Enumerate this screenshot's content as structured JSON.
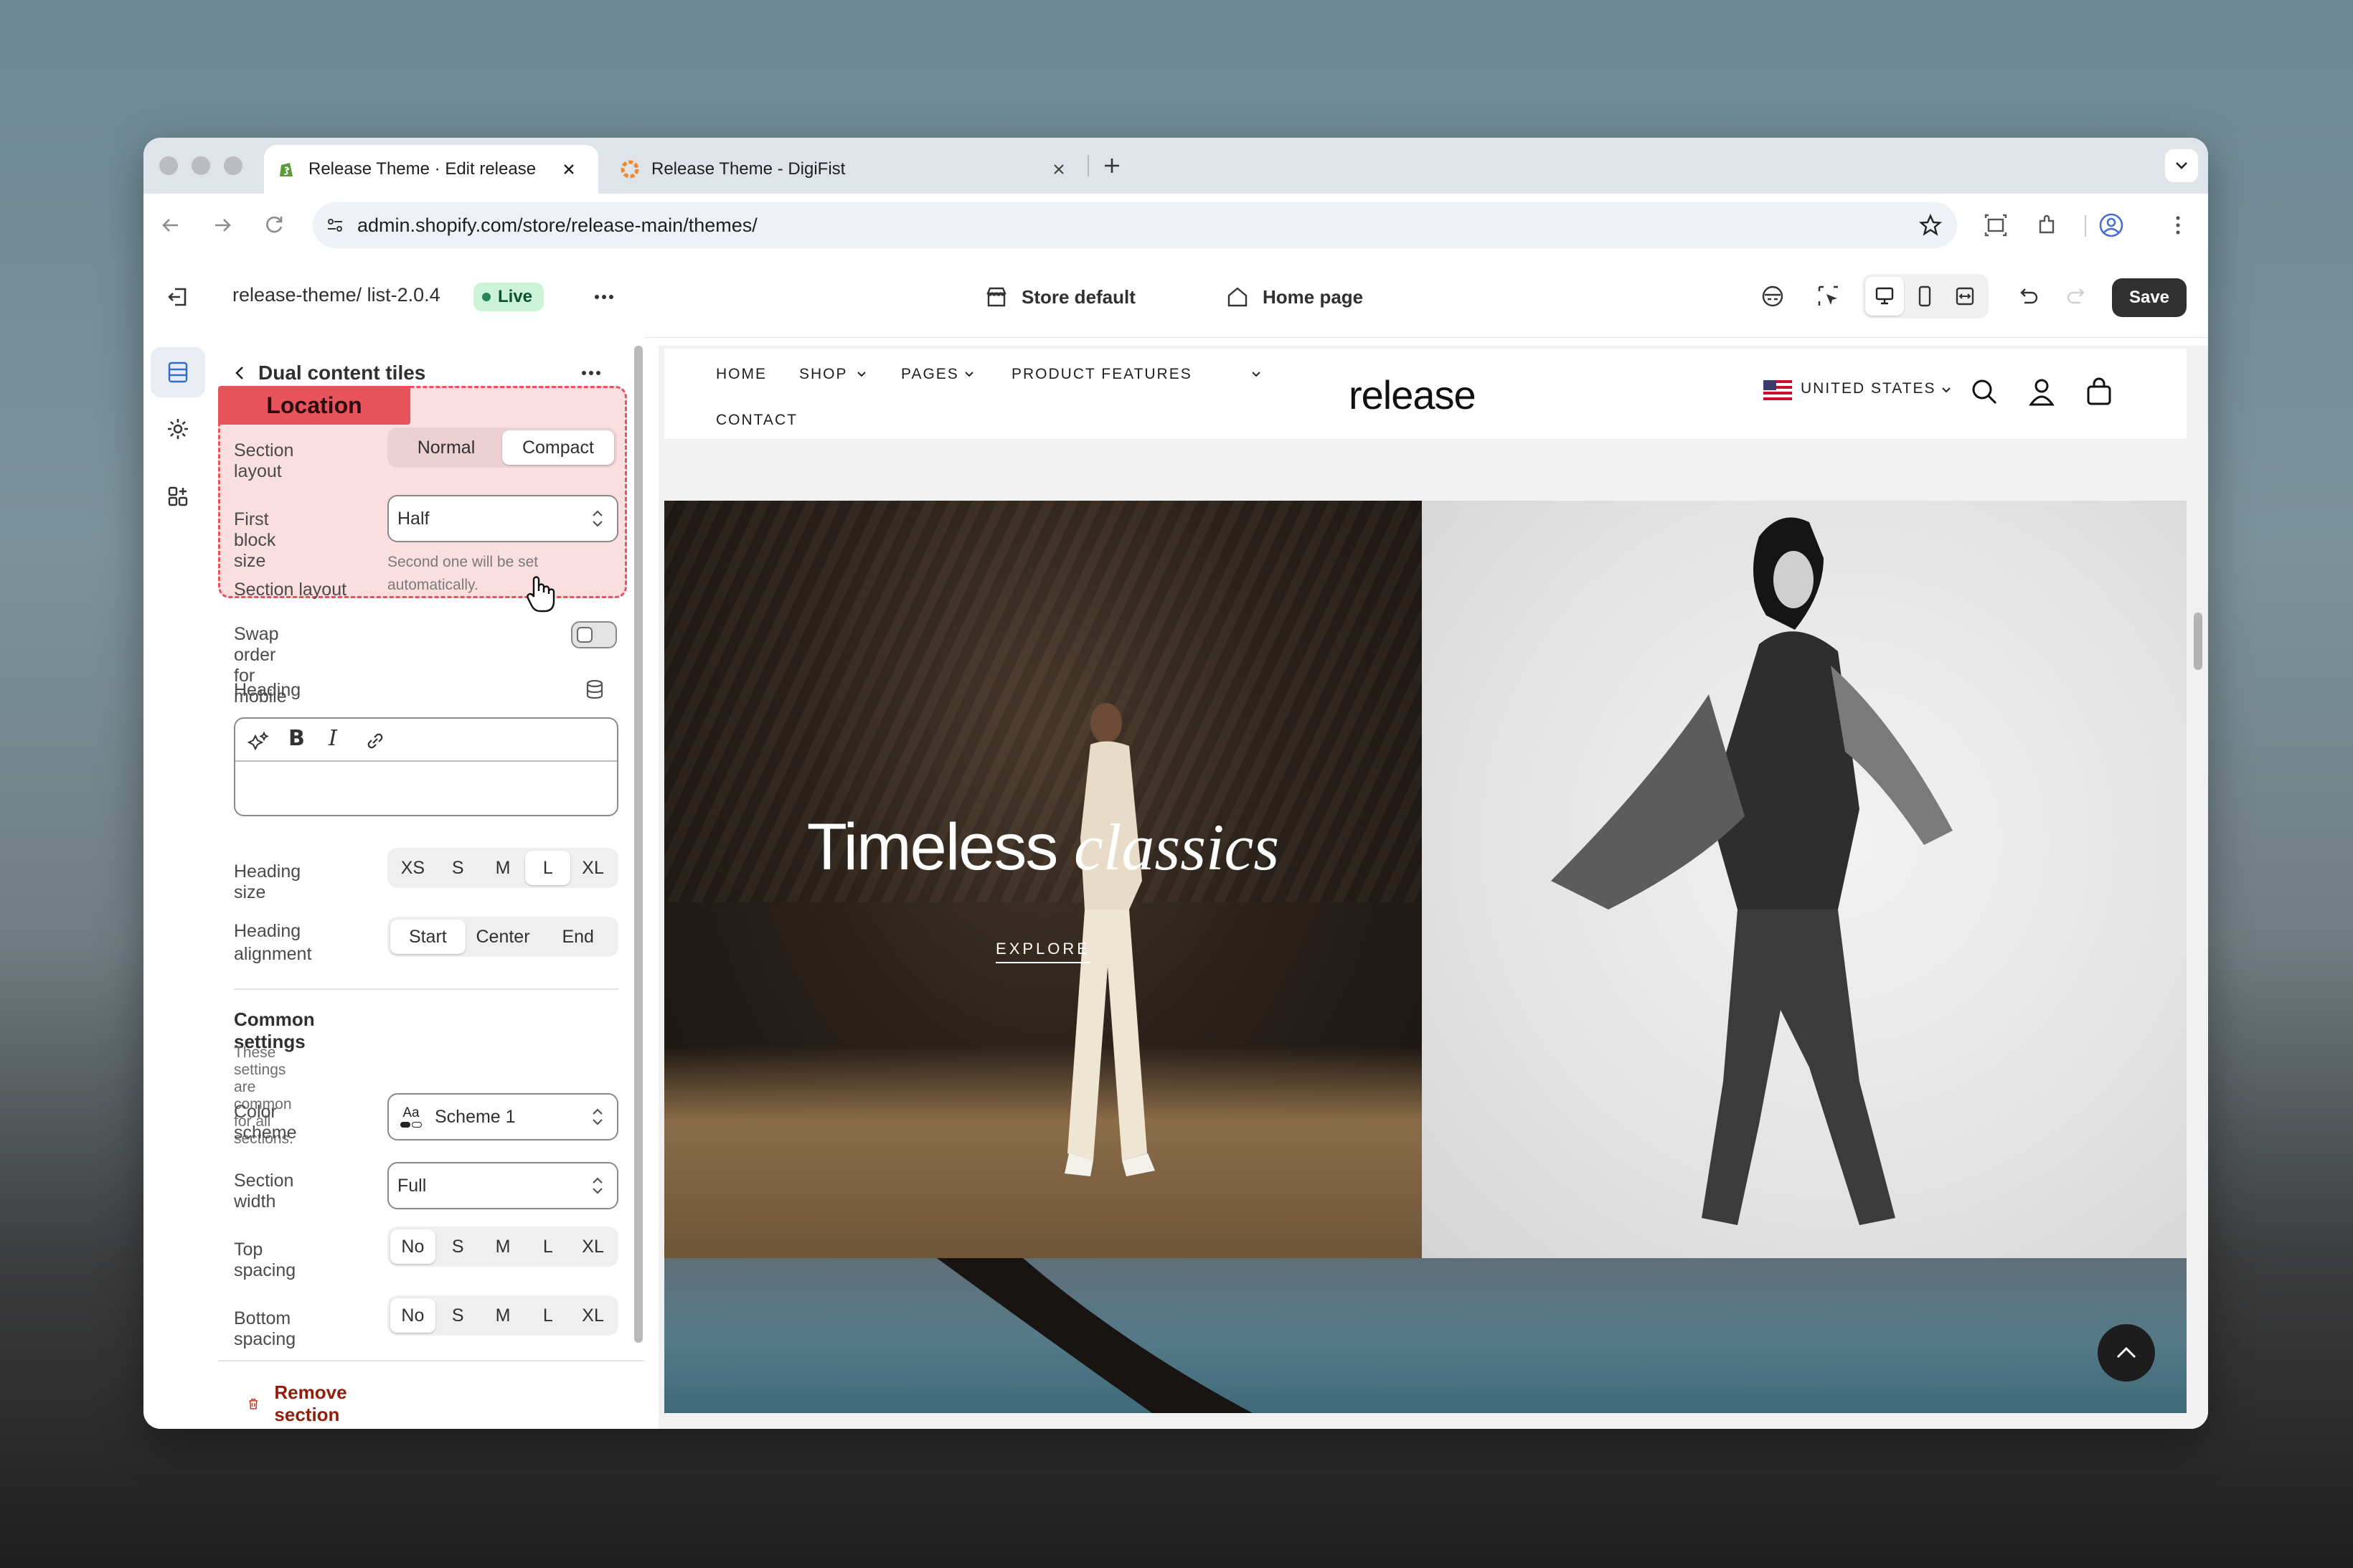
{
  "browser": {
    "tabs": [
      {
        "title": "Release Theme · Edit release",
        "active": true
      },
      {
        "title": "Release Theme - DigiFist",
        "active": false
      }
    ],
    "url": "admin.shopify.com/store/release-main/themes/"
  },
  "editor": {
    "theme_name": "release-theme/ list-2.0.4",
    "live_label": "Live",
    "store_selector": "Store default",
    "page_selector": "Home page",
    "save_label": "Save"
  },
  "panel": {
    "section_title": "Dual content tiles",
    "annotation_label": "Location",
    "section_layout": {
      "label": "Section layout",
      "options": [
        "Normal",
        "Compact"
      ],
      "selected": "Compact"
    },
    "first_block_size": {
      "label": "First block size",
      "value": "Half",
      "help": "Second one will be set automatically."
    },
    "swap_order": {
      "label": "Swap order for mobile",
      "on": false
    },
    "heading": {
      "label": "Heading"
    },
    "heading_size": {
      "label": "Heading size",
      "options": [
        "XS",
        "S",
        "M",
        "L",
        "XL"
      ],
      "selected": "L"
    },
    "heading_alignment": {
      "label": "Heading alignment",
      "options": [
        "Start",
        "Center",
        "End"
      ],
      "selected": "Start"
    },
    "common": {
      "title": "Common settings",
      "description": "These settings are common for all sections.",
      "color_scheme": {
        "label": "Color scheme",
        "value": "Scheme 1",
        "icon_text": "Aa"
      },
      "section_width": {
        "label": "Section width",
        "value": "Full"
      },
      "top_spacing": {
        "label": "Top spacing",
        "options": [
          "No",
          "S",
          "M",
          "L",
          "XL"
        ],
        "selected": "No"
      },
      "bottom_spacing": {
        "label": "Bottom spacing",
        "options": [
          "No",
          "S",
          "M",
          "L",
          "XL"
        ],
        "selected": "No"
      }
    },
    "remove_label": "Remove section"
  },
  "site": {
    "nav": [
      "HOME",
      "SHOP",
      "PAGES",
      "PRODUCT FEATURES",
      "CONTACT"
    ],
    "logo": "release",
    "country": "UNITED STATES",
    "hero_heading_plain": "Timeless",
    "hero_heading_italic": "classics",
    "hero_cta": "EXPLORE"
  },
  "colors": {
    "accent_annotation": "#e8535b",
    "live_green": "#cdf3d7",
    "remove_red": "#8e1f0b"
  }
}
